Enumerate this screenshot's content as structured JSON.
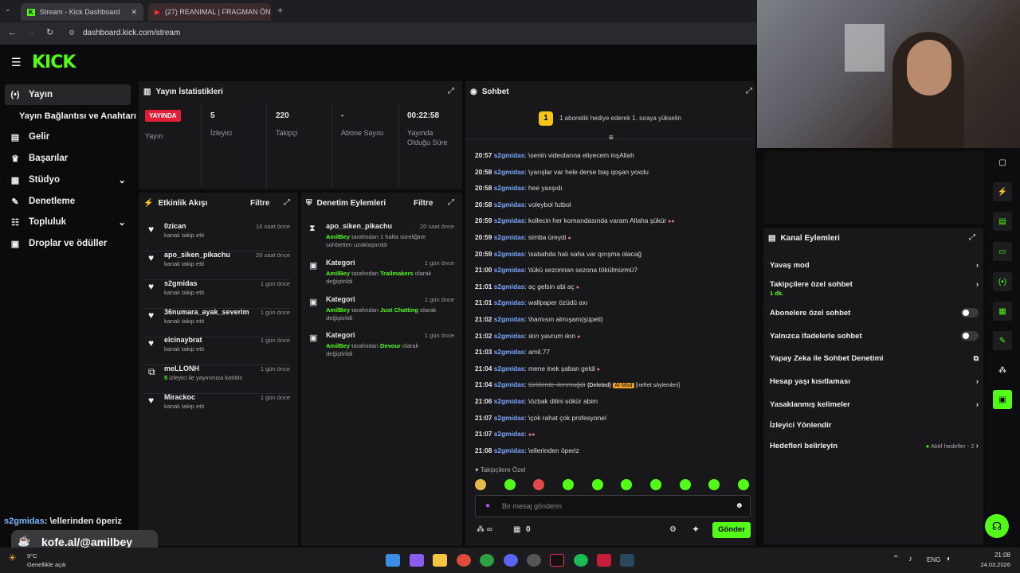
{
  "browser": {
    "tab1": "Stream - Kick Dashboard",
    "tab2": "(27) REANIMAL | FRAGMAN ÖN",
    "url": "dashboard.kick.com/stream"
  },
  "sidebar": {
    "items": [
      "Yayın",
      "Yayın Bağlantısı ve Anahtarı",
      "Gelir",
      "Başarılar",
      "Stüdyo",
      "Denetleme",
      "Topluluk",
      "Droplar ve ödüller"
    ]
  },
  "stats": {
    "title": "Yayın İstatistikleri",
    "live_badge": "YAYINDA",
    "live_label": "Yayın",
    "viewers": "5",
    "viewers_label": "İzleyici",
    "followers": "220",
    "followers_label": "Takipçi",
    "subs": "-",
    "subs_label": "Abone Sayısı",
    "duration": "00:22:58",
    "duration_label1": "Yayında",
    "duration_label2": "Olduğu Süre"
  },
  "activity": {
    "title": "Etkinlik Akışı",
    "filter": "Filtre",
    "items": [
      {
        "name": "0zican",
        "sub": "kanalı takip etti",
        "time": "16 saat önce"
      },
      {
        "name": "apo_siken_pikachu",
        "sub": "kanalı takip etti",
        "time": "20 saat önce"
      },
      {
        "name": "s2gmidas",
        "sub": "kanalı takip etti",
        "time": "1 gün önce"
      },
      {
        "name": "36numara_ayak_severim",
        "sub": "kanalı takip etti",
        "time": "1 gün önce"
      },
      {
        "name": "elcinaybrat",
        "sub": "kanalı takip etti",
        "time": "1 gün önce"
      },
      {
        "name": "meLLONH",
        "sub_count": "5",
        "sub": "izleyici ile yayınınıza katıldı!",
        "time": "1 gün önce"
      },
      {
        "name": "Mirackoc",
        "sub": "kanalı takip etti",
        "time": "1 gün önce"
      }
    ]
  },
  "mod": {
    "title": "Denetim Eylemleri",
    "filter": "Filtre",
    "items": [
      {
        "name": "apo_siken_pikachu",
        "time": "20 saat önce",
        "by": "AmilBey",
        "line1": "tarafından 1 hafta süreliğine",
        "line2": "sohbetten uzaklaştırıldı",
        "cat": ""
      },
      {
        "name": "Kategori",
        "time": "1 gün önce",
        "by": "AmilBey",
        "line1": "tarafından",
        "cat": "Trailmakers",
        "line1b": "olarak",
        "line2": "değiştirildi"
      },
      {
        "name": "Kategori",
        "time": "1 gün önce",
        "by": "AmilBey",
        "line1": "tarafından",
        "cat": "Just Chatting",
        "line1b": "olarak",
        "line2": "değiştirildi"
      },
      {
        "name": "Kategori",
        "time": "1 gün önce",
        "by": "AmilBey",
        "line1": "tarafından",
        "cat": "Devour",
        "line1b": "olarak",
        "line2": "değiştirildi"
      }
    ]
  },
  "chat": {
    "title": "Sohbet",
    "goal_num": "1",
    "goal_text": "1 abonelik hediye ederek 1. sıraya yükselin",
    "messages": [
      {
        "t": "20:57",
        "u": "s2gmidas",
        "m": "\\senin videolarına eliyecem inşAllah"
      },
      {
        "t": "20:58",
        "u": "s2gmidas",
        "m": "\\yarışlar var hele derse baş qoşan yoxdu"
      },
      {
        "t": "20:58",
        "u": "s2gmidas",
        "m": "hee yaxşıdı"
      },
      {
        "t": "20:58",
        "u": "s2gmidas",
        "m": "voleybol futbol"
      },
      {
        "t": "20:59",
        "u": "s2gmidas",
        "m": "kollecin her komandasında varam Allaha şükür"
      },
      {
        "t": "20:59",
        "u": "s2gmidas",
        "m": "simba üreydi"
      },
      {
        "t": "20:59",
        "u": "s2gmidas",
        "m": "\\sabahda halı saha var qırışma olacağ"
      },
      {
        "t": "21:00",
        "u": "s2gmidas",
        "m": "\\tükü sezonnan sezona tökülmürmü?"
      },
      {
        "t": "21:01",
        "u": "s2gmidas",
        "m": "aç gelsin abi aç"
      },
      {
        "t": "21:01",
        "u": "s2gmidas",
        "m": "wallpaper özüdü axı"
      },
      {
        "t": "21:02",
        "u": "s2gmidas",
        "m": "\\hamısın almışam(şüpeli)"
      },
      {
        "t": "21:02",
        "u": "s2gmidas",
        "m": "ıkın yavrum ıkın"
      },
      {
        "t": "21:03",
        "u": "s2gmidas",
        "m": "amil.77"
      },
      {
        "t": "21:04",
        "u": "s2gmidas",
        "m": "mene inek şaban geldi"
      },
      {
        "t": "21:04",
        "u": "s2gmidas",
        "m": "türklerde ıkınmağdı",
        "deleted": "(Deleted)",
        "aimod": "AI Mod",
        "reason": "[nefret söylemleri]"
      },
      {
        "t": "21:06",
        "u": "s2gmidas",
        "m": "\\özbak dilini sökür abim"
      },
      {
        "t": "21:07",
        "u": "s2gmidas",
        "m": "\\çok rahat çok profesyonel"
      },
      {
        "t": "21:07",
        "u": "s2gmidas",
        "m": ""
      },
      {
        "t": "21:08",
        "u": "s2gmidas",
        "m": "\\ellerinden öperiz"
      }
    ],
    "follower_only": "Takipçilere Özel",
    "placeholder": "Bir mesaj gönderin",
    "points": "0",
    "send": "Gönder"
  },
  "channel": {
    "title": "Kanal Eylemleri",
    "items": [
      "Yavaş mod",
      "Takipçilere özel sohbet",
      "Abonelere özel sohbet",
      "Yalnızca ifadelerle sohbet",
      "Yapay Zeka ile Sohbet Denetimi",
      "Hesap yaşı kısıtlaması",
      "Yasaklanmış kelimeler",
      "İzleyici Yönlendir",
      "Hedefleri belirleyin"
    ],
    "follower_sub": "1 dk.",
    "goals_status": "Aktif hedefler - 2"
  },
  "overlay": {
    "chat_user": "s2gmidas",
    "chat_msg": ": \\ellerinden öperiz",
    "kofe": "kofe.al/@amilbey"
  },
  "weather": {
    "temp": "9°C",
    "desc": "Genellikle açık"
  },
  "tray": {
    "lang": "ENG",
    "time": "21:08",
    "date": "24.03.2026"
  },
  "colors": {
    "kick_green": "#53fc18",
    "live_red": "#e01e36",
    "ai_orange": "#f5a623"
  }
}
